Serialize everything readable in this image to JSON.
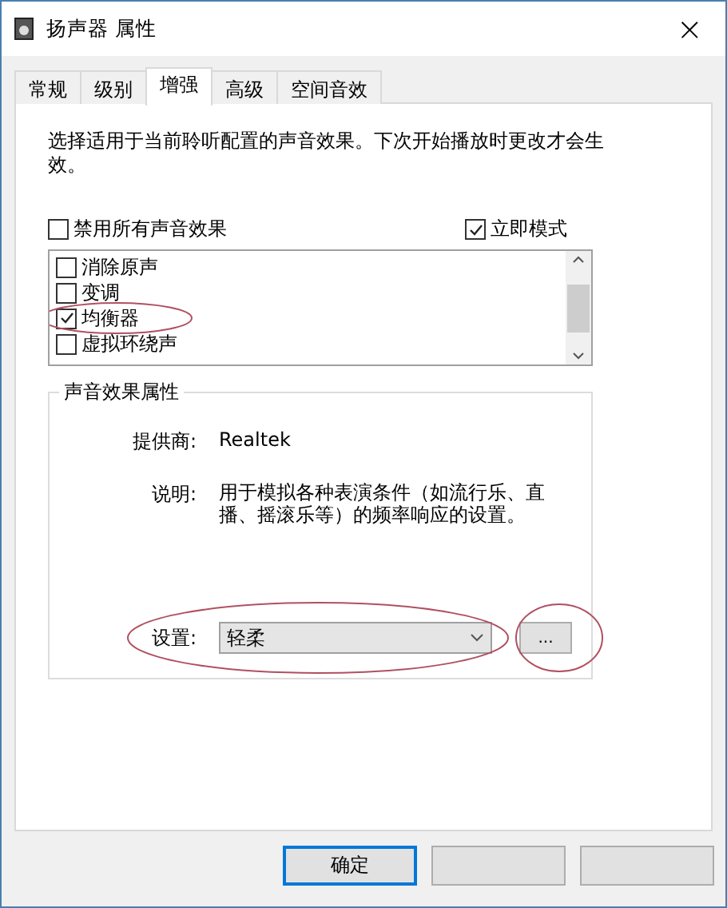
{
  "window": {
    "title": "扬声器 属性",
    "close": "×"
  },
  "tabs": [
    {
      "label": "常规",
      "selected": false
    },
    {
      "label": "级别",
      "selected": false
    },
    {
      "label": "增强",
      "selected": true
    },
    {
      "label": "高级",
      "selected": false
    },
    {
      "label": "空间音效",
      "selected": false
    }
  ],
  "intro": "选择适用于当前聆听配置的声音效果。下次开始播放时更改才会生效。",
  "options": [
    {
      "label": "禁用所有声音效果",
      "checked": false
    },
    {
      "label": "立即模式",
      "checked": true
    }
  ],
  "effects": [
    {
      "label": "消除原声",
      "checked": false,
      "circled": false
    },
    {
      "label": "变调",
      "checked": false,
      "circled": false
    },
    {
      "label": "均衡器",
      "checked": true,
      "circled": true
    },
    {
      "label": "虚拟环绕声",
      "checked": false,
      "circled": false
    }
  ],
  "properties": {
    "legend": "声音效果属性",
    "provider_label": "提供商:",
    "provider": "Realtek",
    "description_label": "说明:",
    "description": "用于模拟各种表演条件（如流行乐、直播、摇滚乐等）的频率响应的设置。",
    "setting_label": "设置:",
    "setting": "轻柔",
    "setting_circled": true,
    "more": "...",
    "more_circled": true
  },
  "buttons": [
    {
      "label": "确定",
      "default": true
    },
    {
      "default": false
    },
    {
      "default": false
    }
  ]
}
